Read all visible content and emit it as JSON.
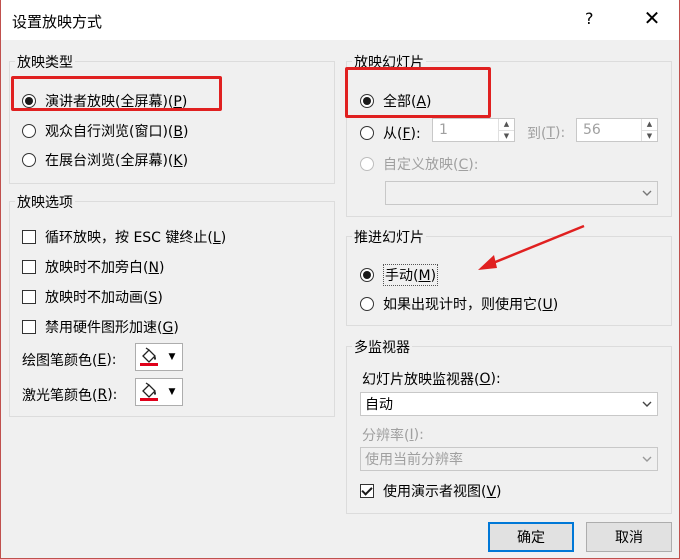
{
  "window": {
    "title": "设置放映方式",
    "help": "?",
    "close": "✕"
  },
  "show_type": {
    "legend": "放映类型",
    "options": [
      {
        "label": "演讲者放映(全屏幕)(",
        "key": "P",
        "end": ")",
        "selected": true
      },
      {
        "label": "观众自行浏览(窗口)(",
        "key": "B",
        "end": ")",
        "selected": false
      },
      {
        "label": "在展台浏览(全屏幕)(",
        "key": "K",
        "end": ")",
        "selected": false
      }
    ]
  },
  "show_options": {
    "legend": "放映选项",
    "checks": [
      {
        "label": "循环放映，按 ESC 键终止(",
        "key": "L",
        "end": ")",
        "checked": false
      },
      {
        "label": "放映时不加旁白(",
        "key": "N",
        "end": ")",
        "checked": false
      },
      {
        "label": "放映时不加动画(",
        "key": "S",
        "end": ")",
        "checked": false
      },
      {
        "label": "禁用硬件图形加速(",
        "key": "G",
        "end": ")",
        "checked": false
      }
    ],
    "pen_color": {
      "label": "绘图笔颜色(",
      "key": "E",
      "end": "):"
    },
    "laser_color": {
      "label": "激光笔颜色(",
      "key": "R",
      "end": "):"
    }
  },
  "slides": {
    "legend": "放映幻灯片",
    "all": {
      "label": "全部(",
      "key": "A",
      "end": ")",
      "selected": true
    },
    "from": {
      "label": "从(",
      "key": "F",
      "end": "):",
      "value": "1"
    },
    "to": {
      "label": "到(",
      "key": "T",
      "end": "):",
      "value": "56"
    },
    "custom": {
      "label": "自定义放映(",
      "key": "C",
      "end": "):"
    },
    "custom_value": ""
  },
  "advance": {
    "legend": "推进幻灯片",
    "manual": {
      "label": "手动(",
      "key": "M",
      "end": ")",
      "selected": true
    },
    "timing": {
      "label": "如果出现计时，则使用它(",
      "key": "U",
      "end": ")",
      "selected": false
    }
  },
  "monitors": {
    "legend": "多监视器",
    "monitor_label": {
      "label": "幻灯片放映监视器(",
      "key": "O",
      "end": "):"
    },
    "monitor_value": "自动",
    "resolution_label": {
      "label": "分辨率(",
      "key": "I",
      "end": "):"
    },
    "resolution_value": "使用当前分辨率",
    "presenter_view": {
      "label": "使用演示者视图(",
      "key": "V",
      "end": ")",
      "checked": true
    }
  },
  "buttons": {
    "ok": "确定",
    "cancel": "取消"
  },
  "colors": {
    "annotation": "#e02020",
    "primary_border": "#0078d7",
    "pen_bar": "#e0001a"
  }
}
